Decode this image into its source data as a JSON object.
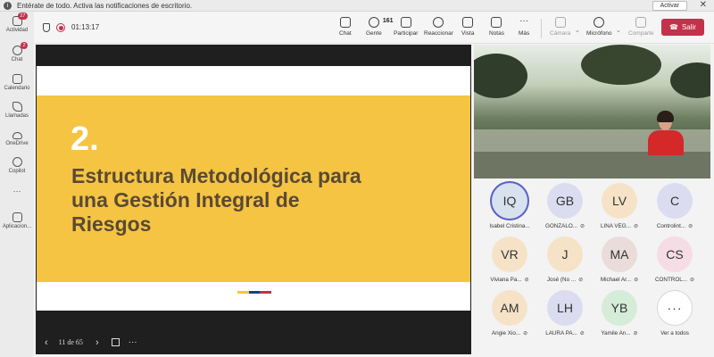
{
  "notification": {
    "text": "Entérate de todo. Activa las notificaciones de escritorio.",
    "button": "Activar",
    "close": "✕"
  },
  "rail": [
    {
      "label": "Actividad",
      "badge": "27"
    },
    {
      "label": "Chat",
      "badge": "2"
    },
    {
      "label": "Calendario",
      "badge": ""
    },
    {
      "label": "Llamadas",
      "badge": ""
    },
    {
      "label": "OneDrive",
      "badge": ""
    },
    {
      "label": "Copilot",
      "badge": ""
    },
    {
      "label": "Aplicacion...",
      "badge": ""
    }
  ],
  "rail_more": "···",
  "meeting": {
    "timer": "01:13:17",
    "participants_count": "161",
    "buttons": {
      "chat": "Chat",
      "people": "Gente",
      "participate": "Participar",
      "react": "Reaccionar",
      "view": "Vista",
      "notes": "Notas",
      "more": "Más",
      "camera": "Cámara",
      "mic": "Micrófono",
      "share": "Comparte",
      "leave": "Salir"
    }
  },
  "slide": {
    "number": "2.",
    "title": "Estructura Metodológica para una Gestión Integral de Riesgos",
    "flag_colors": [
      "#f6c443",
      "#1f3a93",
      "#c4314b"
    ],
    "counter": "11 de 65"
  },
  "participants": [
    {
      "initials": "IQ",
      "name": "Isabel Cristina...",
      "color": "#d7e2ee",
      "speaking": true,
      "muted": false
    },
    {
      "initials": "GB",
      "name": "GONZALO...",
      "color": "#dcdcf0",
      "speaking": false,
      "muted": true
    },
    {
      "initials": "LV",
      "name": "LINA VEG...",
      "color": "#f6e3c7",
      "speaking": false,
      "muted": true
    },
    {
      "initials": "C",
      "name": "Controlint...",
      "color": "#dcdcf0",
      "speaking": false,
      "muted": true
    },
    {
      "initials": "VR",
      "name": "Viviana Pa...",
      "color": "#f6e3c7",
      "speaking": false,
      "muted": true
    },
    {
      "initials": "J",
      "name": "José (No ...",
      "color": "#f6e3c7",
      "speaking": false,
      "muted": true
    },
    {
      "initials": "MA",
      "name": "Michael Ar...",
      "color": "#e9dcd9",
      "speaking": false,
      "muted": true
    },
    {
      "initials": "CS",
      "name": "CONTROL...",
      "color": "#f6dce4",
      "speaking": false,
      "muted": true
    },
    {
      "initials": "AM",
      "name": "Angie Xio...",
      "color": "#f6e3c7",
      "speaking": false,
      "muted": true
    },
    {
      "initials": "LH",
      "name": "LAURA PA...",
      "color": "#dcdcf0",
      "speaking": false,
      "muted": true
    },
    {
      "initials": "YB",
      "name": "Yamile An...",
      "color": "#d5ecd9",
      "speaking": false,
      "muted": true
    }
  ],
  "see_all": "Ver a todos"
}
